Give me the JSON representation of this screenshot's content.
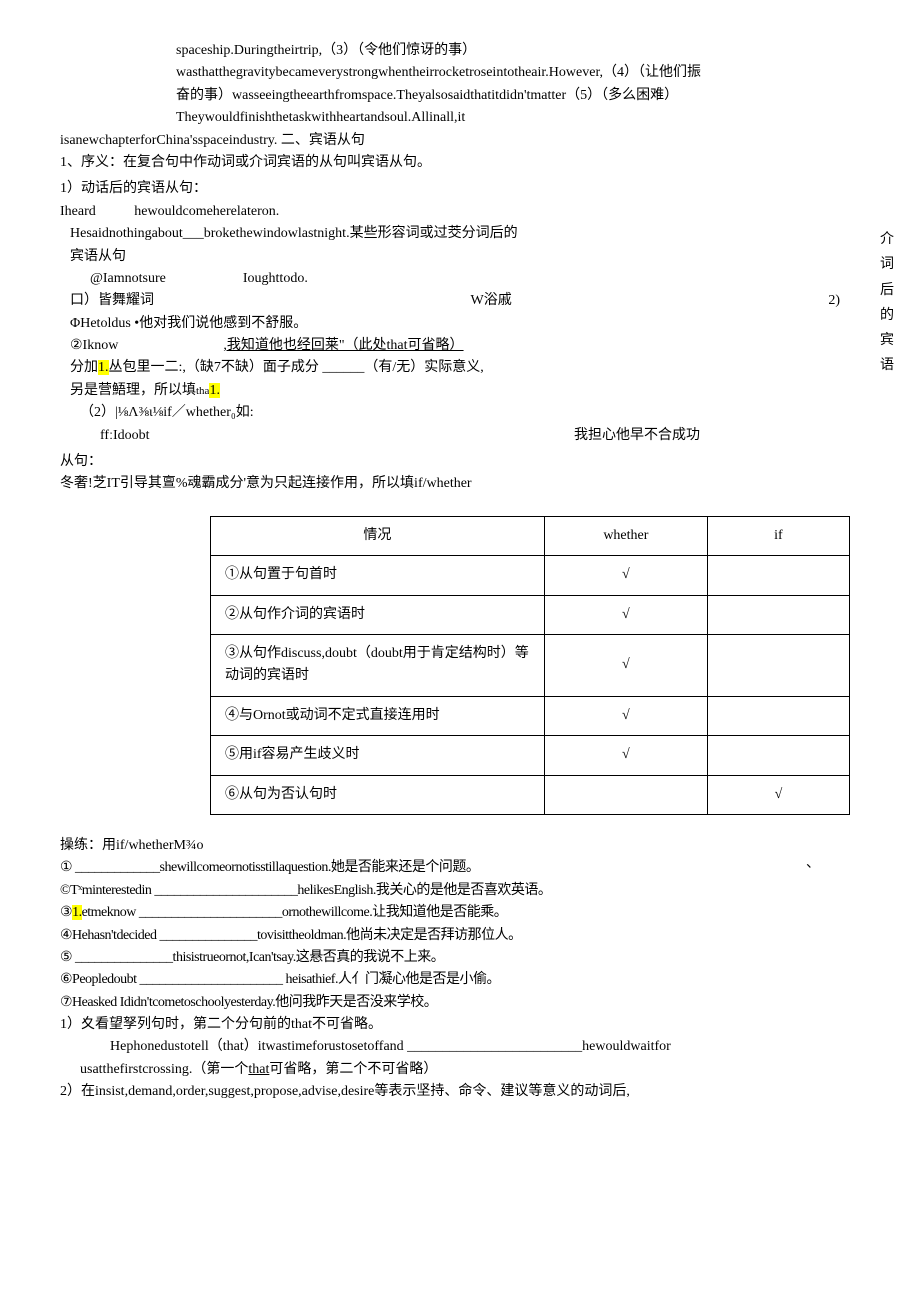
{
  "intro": {
    "l1": "spaceship.Duringtheirtrip,（3）（令他们惊讶的事）",
    "l2": "wasthatthegravitybecameverystrongwhentheirrocketroseintotheair.However,（4）（让他们振",
    "l3": "奋的事）wasseeingtheearthfromspace.Theyalsosaidthatitdidn'tmatter（5）（多么困难）",
    "l4": "Theywouldfinishthetaskwithheartandsoul.Allinall,it",
    "l5a": "isanewchapterforChina'sspaceindustry.",
    "l5b": "二、宾语从句",
    "def": "1、序义：在复合句中作动词或介词宾语的从句叫宾语从句。"
  },
  "dong": {
    "title": "1）动话后的宾语从句：",
    "l1a": "Iheard",
    "l1b": "hewouldcomeherelateron.",
    "l2": "Hesaidnothingabout___brokethewindowlastnight.某些形容词或过茭分词后的",
    "l3": "宾语从句",
    "l4a": "@Iamnotsure",
    "l4b": "Ioughttodo.",
    "l5a": "口）皆舞耀词",
    "l5b": "W浴戚",
    "l5c": "2)",
    "l6a": "ΦHetoldus",
    "l6b": "•他对我们说他感到不舒服。",
    "l7a": "②Iknow",
    "l7b": ",我知道他也经回莱\"（此处that可省略）",
    "l8": "分加1.丛包里一二:,（缺7不缺）面子成分 ______（有/无）实际意义,",
    "l9": "另是营鯃理，所以填tha1.",
    "l10": "（2）|⅛Λ⅜ι⅛if／whether₀如:",
    "l11a": "ffːIdoobt",
    "l11b": "我担心他早不合成功"
  },
  "side": {
    "c1": "介",
    "c2": "词",
    "c3": "后",
    "c4": "的",
    "c5": "宾",
    "c6": "语"
  },
  "cong": {
    "l1": "从句：",
    "l2": "冬奢!芝IT引导其亶%魂霸成分'意为只起连接作用，所以填if/whether"
  },
  "table": {
    "h1": "情况",
    "h2": "whether",
    "h3": "if",
    "r1": "①从句置于句首时",
    "r2": "②从句作介词的宾语时",
    "r3": "③从句作discuss,doubt（doubt用于肯定结构时）等动词的宾语时",
    "r4": "④与Ornot或动词不定式直接连用时",
    "r5": "⑤用if容易产生歧义时",
    "r6": "⑥从句为否认句时",
    "chk": "√"
  },
  "practice": {
    "title": "操练：用if/whetherM¾o",
    "tick": "、",
    "l1": "① _____________shewillcomeornotisstillaquestion.她是否能来还是个问题。",
    "l2": "©Tˣminterestedin ______________________helikesEnglish.我关心的是他是否喜欢英语。",
    "l3a": "③",
    "l3b": "1.",
    "l3c": "etmeknow ______________________ornothewillcome.让我知道他是否能乘。",
    "l4": "④Hehasn'tdecided _______________tovisittheoldman.他尚未决定是否拜访那位人。",
    "l5": "⑤ _______________thisistrueornot,Ican'tsay.这悬否真的我说不上来。",
    "l6": "⑥Peopledoubt ______________________ heisathief.人亻门凝心他是否是小偷。",
    "l7": "⑦Heasked Ididn'tcometoschoolyesterday.他问我昨天是否没来学校。"
  },
  "notes": {
    "n1": "1）夊看望孥列句时，第二个分句前的that不可省略。",
    "n2a": "Hephonedustotell（that）itwastimeforustosetoffand _________________________hewouldwaitfor",
    "n2b": "usatthefirstcrossing.（第一个",
    "n2c": "that",
    "n2d": "可省略，第二个不可省略）",
    "n3": "2）在insist,demand,order,suggest,propose,advise,desire等表示坚持、命令、建议等意义的动词后,"
  }
}
